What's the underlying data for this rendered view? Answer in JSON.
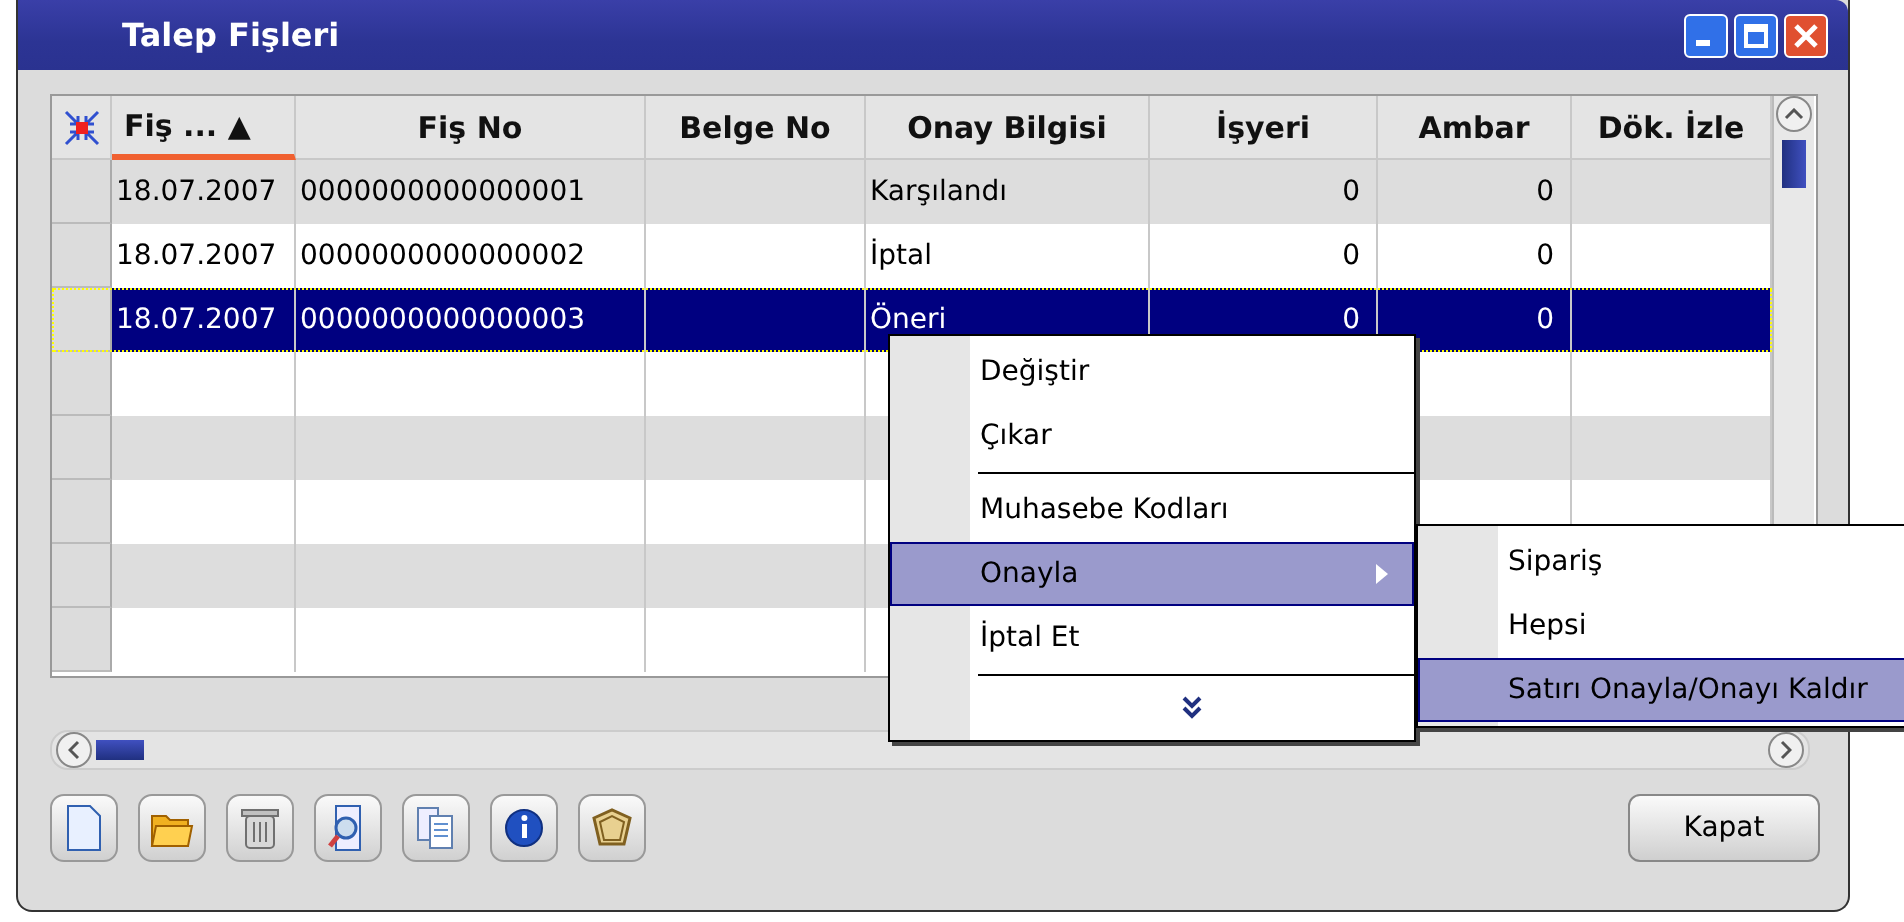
{
  "window": {
    "title": "Talep Fişleri"
  },
  "table": {
    "columns": [
      {
        "label": "Fiş ... ▲",
        "sorted": true
      },
      {
        "label": "Fiş No",
        "sorted": false
      },
      {
        "label": "Belge No",
        "sorted": false
      },
      {
        "label": "Onay Bilgisi",
        "sorted": false
      },
      {
        "label": "İşyeri",
        "sorted": false
      },
      {
        "label": "Ambar",
        "sorted": false
      },
      {
        "label": "Dök. İzle",
        "sorted": false
      }
    ],
    "rows": [
      {
        "cells": [
          "18.07.2007",
          "0000000000000001",
          "",
          "Karşılandı",
          "0",
          "0",
          ""
        ],
        "selected": false
      },
      {
        "cells": [
          "18.07.2007",
          "0000000000000002",
          "",
          "İptal",
          "0",
          "0",
          ""
        ],
        "selected": false
      },
      {
        "cells": [
          "18.07.2007",
          "0000000000000003",
          "",
          "Öneri",
          "0",
          "0",
          ""
        ],
        "selected": true
      }
    ]
  },
  "context_menu": {
    "items": [
      {
        "kind": "item",
        "label": "Değiştir",
        "selected": false,
        "submenu": false
      },
      {
        "kind": "item",
        "label": "Çıkar",
        "selected": false,
        "submenu": false
      },
      {
        "kind": "separator"
      },
      {
        "kind": "item",
        "label": "Muhasebe Kodları",
        "selected": false,
        "submenu": false
      },
      {
        "kind": "item",
        "label": "Onayla",
        "selected": true,
        "submenu": true
      },
      {
        "kind": "item",
        "label": "İptal Et",
        "selected": false,
        "submenu": false
      },
      {
        "kind": "separator"
      },
      {
        "kind": "more"
      }
    ],
    "submenu": {
      "items": [
        {
          "label": "Sipariş",
          "selected": false
        },
        {
          "label": "Hepsi",
          "selected": false
        },
        {
          "label": "Satırı Onayla/Onayı Kaldır",
          "selected": true
        }
      ]
    }
  },
  "toolbar": [
    {
      "kind": "new"
    },
    {
      "kind": "open"
    },
    {
      "kind": "delete"
    },
    {
      "kind": "preview"
    },
    {
      "kind": "copy"
    },
    {
      "kind": "info"
    },
    {
      "kind": "shape"
    }
  ],
  "close_button": {
    "label": "Kapat"
  }
}
